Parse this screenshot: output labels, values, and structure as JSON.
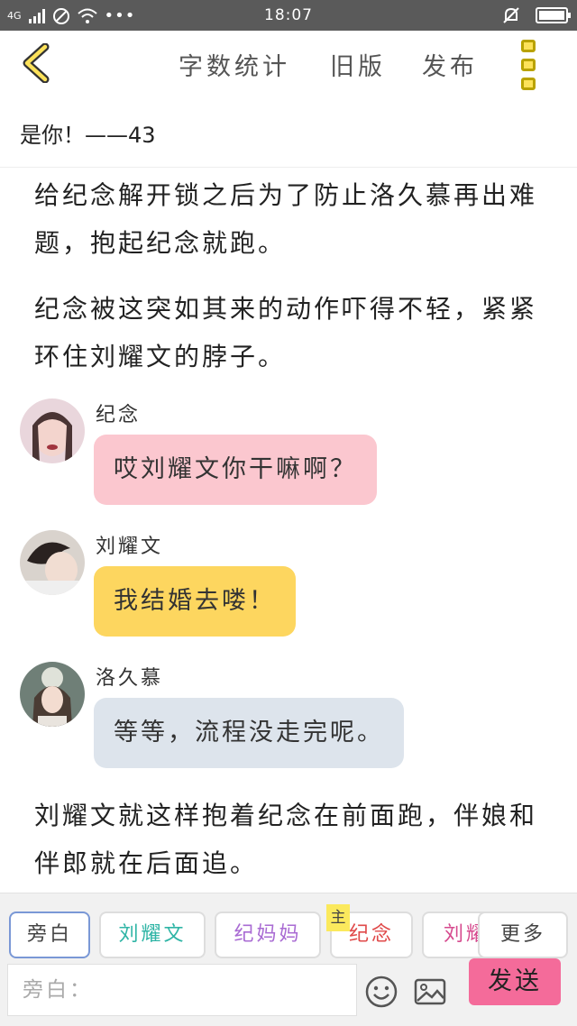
{
  "status_bar": {
    "network": "4G",
    "time": "18:07"
  },
  "header": {
    "word_count": "字数统计",
    "old_version": "旧版",
    "publish": "发布"
  },
  "chapter_title": "是你！——43",
  "story": {
    "paragraph_1": "给纪念解开锁之后为了防止洛久慕再出难题，抱起纪念就跑。",
    "paragraph_2": "纪念被这突如其来的动作吓得不轻，紧紧环住刘耀文的脖子。",
    "messages": [
      {
        "speaker": "纪念",
        "text": "哎刘耀文你干嘛啊？",
        "bubble_color": "#fbc7cf"
      },
      {
        "speaker": "刘耀文",
        "text": "我结婚去喽！",
        "bubble_color": "#fdd65f"
      },
      {
        "speaker": "洛久慕",
        "text": "等等，流程没走完呢。",
        "bubble_color": "#dde4ec"
      }
    ],
    "paragraph_3": "刘耀文就这样抱着纪念在前面跑，伴娘和伴郎就在后面追。"
  },
  "role_bar": {
    "roles": [
      {
        "label": "旁白",
        "color": "#444444"
      },
      {
        "label": "刘耀文",
        "color": "#30b5a6"
      },
      {
        "label": "纪妈妈",
        "color": "#a96bd3"
      },
      {
        "label": "纪念",
        "color": "#e04a4a"
      },
      {
        "label": "刘耀",
        "color": "#d64a8e"
      }
    ],
    "main_tag": "主",
    "more": "更多"
  },
  "composer": {
    "placeholder": "旁白：",
    "send_label": "发送"
  },
  "colors": {
    "accent_yellow": "#fde25a",
    "send_pink": "#f46b9a"
  }
}
